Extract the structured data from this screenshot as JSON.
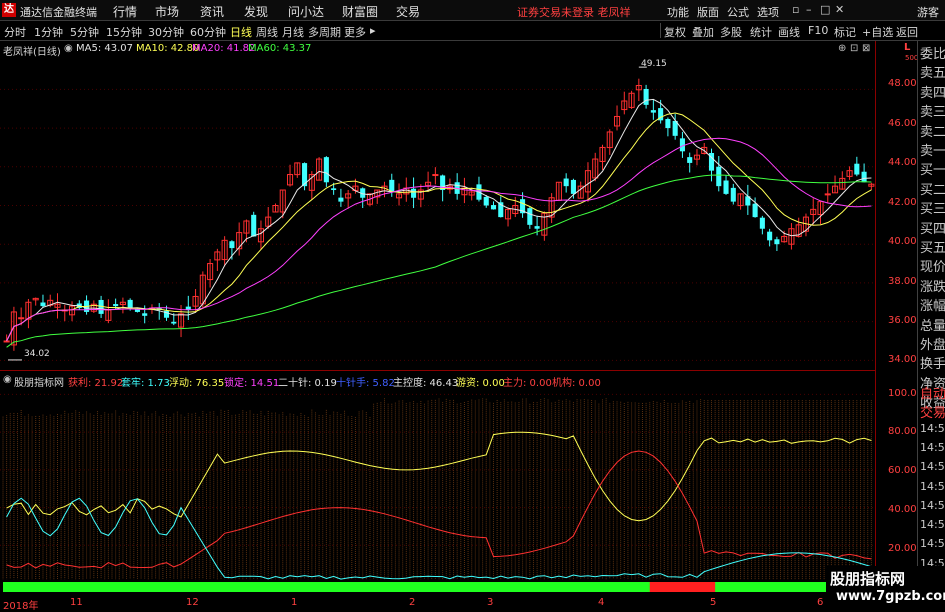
{
  "menubar": {
    "app_title": "通达信金融终端",
    "items": [
      "行情",
      "市场",
      "资讯",
      "发现",
      "问小达",
      "财富圈",
      "交易"
    ],
    "notice": "证券交易未登录",
    "user": "老凤祥",
    "right_items": [
      "功能",
      "版面",
      "公式",
      "选项"
    ],
    "guest": "游客"
  },
  "toolbar": {
    "periods": [
      "分时",
      "1分钟",
      "5分钟",
      "15分钟",
      "30分钟",
      "60分钟",
      "日线",
      "周线",
      "月线",
      "多周期",
      "更多"
    ],
    "selected": "日线",
    "right_buttons": [
      "复权",
      "叠加",
      "多股",
      "统计",
      "画线",
      "F10",
      "标记",
      "+自选",
      "返回"
    ]
  },
  "main_legend": {
    "stock": "老凤祥(日线)",
    "ma5": "MA5: 43.07",
    "ma10": "MA10: 42.80",
    "ma20": "MA20: 41.82",
    "ma60": "MA60: 43.37"
  },
  "annotations": {
    "high": "49.15",
    "low": "34.02"
  },
  "y_main": [
    "48.00",
    "46.00",
    "44.00",
    "42.00",
    "40.00",
    "38.00",
    "36.00",
    "34.00"
  ],
  "y_sub": [
    "100.0",
    "80.00",
    "60.00",
    "40.00",
    "20.00"
  ],
  "axis_corner": {
    "l": "L",
    "num": "500"
  },
  "sub_legend": {
    "name": "股朋指标网",
    "huoli": "获利: 21.92",
    "taolao": "套牢: 1.73",
    "fudong": "浮动: 76.35",
    "suoding": "锁定: 14.51",
    "ershi": "二十针: 0.19",
    "shizhen": "十针手: 5.82",
    "zhukong": "主控度: 46.43",
    "youzi": "游资: 0.00",
    "zhuli": "主力: 0.00",
    "jigou": "机构: 0.00"
  },
  "right_panel": [
    "委比",
    "卖五",
    "卖四",
    "卖三",
    "卖二",
    "卖一",
    "买一",
    "买二",
    "买三",
    "买四",
    "买五",
    "现价",
    "涨跌",
    "涨幅",
    "总量",
    "外盘",
    "换手",
    "净资",
    "收益"
  ],
  "right_panel2": [
    "自动",
    "交易",
    "14:5",
    "14:5",
    "14:5",
    "14:5",
    "14:5",
    "14:5",
    "14:5",
    "14:5",
    "14:5"
  ],
  "dates": [
    "2018年",
    "11",
    "12",
    "1",
    "2",
    "3",
    "4",
    "5",
    "6"
  ],
  "watermark": {
    "line1": "股朋指标网",
    "line2": "www.7gpzb.com"
  },
  "chart_data": {
    "type": "candlestick",
    "ylim_main": [
      33.5,
      50.5
    ],
    "ylim_sub": [
      0,
      105
    ],
    "closes": [
      35.0,
      36.5,
      36.2,
      37.0,
      37.2,
      36.8,
      37.1,
      36.9,
      36.6,
      36.8,
      36.7,
      36.5,
      36.9,
      36.4,
      36.6,
      36.8,
      37.0,
      36.7,
      36.5,
      36.3,
      36.7,
      36.6,
      36.2,
      35.9,
      36.4,
      36.6,
      37.3,
      38.4,
      39.0,
      39.6,
      40.2,
      39.8,
      40.6,
      41.2,
      40.4,
      40.8,
      41.4,
      42.0,
      42.8,
      43.6,
      44.2,
      43.0,
      43.6,
      44.4,
      43.2,
      42.8,
      42.2,
      42.6,
      43.0,
      42.4,
      42.6,
      42.8,
      43.0,
      42.7,
      42.6,
      42.9,
      42.4,
      42.8,
      43.2,
      43.6,
      42.8,
      43.0,
      42.6,
      42.9,
      42.7,
      42.3,
      42.0,
      41.8,
      41.4,
      41.8,
      42.0,
      41.6,
      41.0,
      40.8,
      41.6,
      42.4,
      43.2,
      43.0,
      42.6,
      43.0,
      43.8,
      44.4,
      45.0,
      45.8,
      46.6,
      47.4,
      47.8,
      48.2,
      47.2,
      46.8,
      46.4,
      46.0,
      45.6,
      44.8,
      44.2,
      44.6,
      45.0,
      43.8,
      43.0,
      42.6,
      42.2,
      42.6,
      42.0,
      41.4,
      40.8,
      40.2,
      40.0,
      40.4,
      40.8,
      41.0,
      41.4,
      41.8,
      42.2,
      42.6,
      43.0,
      43.4,
      43.8,
      43.6,
      43.2,
      43.1
    ]
  }
}
